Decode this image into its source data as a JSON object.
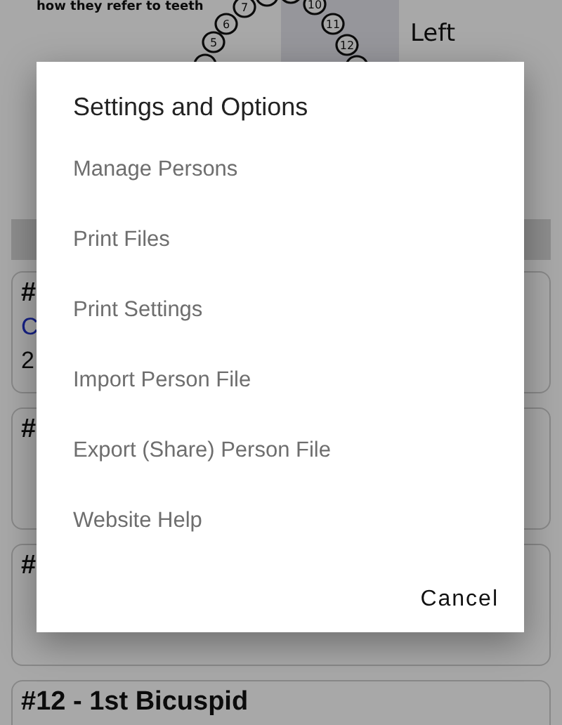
{
  "background": {
    "diagram": {
      "caption": "how they refer to teeth",
      "side_label": [
        "Left"
      ],
      "teeth": [
        "7",
        "6",
        "5",
        "10",
        "11",
        "12"
      ]
    },
    "cards": [
      {
        "lines": [
          {
            "kind": "heading",
            "text": "#"
          },
          {
            "kind": "link",
            "text": "C"
          },
          {
            "kind": "text",
            "text": "2"
          }
        ]
      },
      {
        "lines": [
          {
            "kind": "heading",
            "text": "#"
          }
        ]
      },
      {
        "lines": [
          {
            "kind": "heading",
            "text": "#"
          }
        ]
      },
      {
        "lines": [
          {
            "kind": "heading",
            "text": "#12 - 1st Bicuspid"
          }
        ]
      }
    ]
  },
  "dialog": {
    "title": "Settings and Options",
    "items": [
      "Manage Persons",
      "Print Files",
      "Print Settings",
      "Import Person File",
      "Export (Share) Person File",
      "Website Help"
    ],
    "buttons": [
      "Cancel"
    ]
  }
}
